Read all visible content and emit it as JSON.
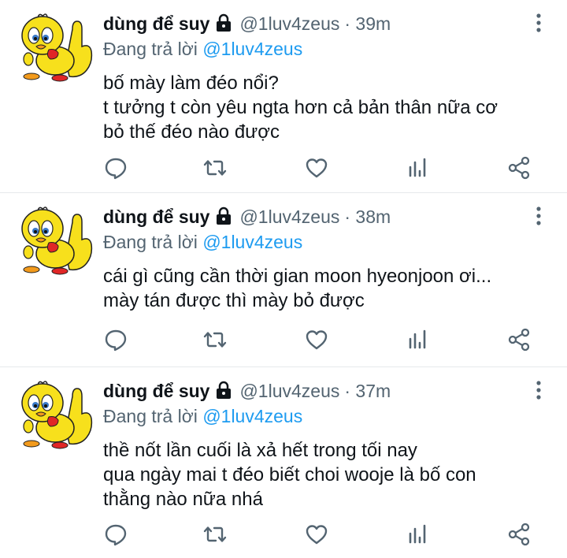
{
  "tweets": [
    {
      "name": "dùng để suy",
      "handle": "@1luv4zeus",
      "time": "· 39m",
      "reply_prefix": "Đang trả lời ",
      "reply_to": "@1luv4zeus",
      "lines": [
        "bố mày làm đéo nổi?",
        "t tưởng t còn yêu ngta hơn cả bản thân nữa cơ",
        "bỏ thế đéo nào được"
      ]
    },
    {
      "name": "dùng để suy",
      "handle": "@1luv4zeus",
      "time": "· 38m",
      "reply_prefix": "Đang trả lời ",
      "reply_to": "@1luv4zeus",
      "lines": [
        "cái gì cũng cần thời gian moon hyeonjoon ơi...",
        "mày tán được thì mày bỏ được"
      ]
    },
    {
      "name": "dùng để suy",
      "handle": "@1luv4zeus",
      "time": "· 37m",
      "reply_prefix": "Đang trả lời ",
      "reply_to": "@1luv4zeus",
      "lines": [
        "thề nốt lần cuối là xả hết trong tối nay",
        "qua ngày mai t đéo biết choi wooje là bố con",
        "thằng nào nữa nhá"
      ]
    }
  ],
  "icons": {
    "reply": "comment-icon",
    "retweet": "retweet-icon",
    "like": "heart-icon",
    "stats": "analytics-icon",
    "share": "share-icon",
    "lock": "lock-icon",
    "more": "more-vertical-icon"
  },
  "colors": {
    "text": "#0f1419",
    "secondary": "#536471",
    "link": "#1d9bf0",
    "avatar_yellow": "#f7e01c",
    "avatar_red": "#e02626"
  }
}
